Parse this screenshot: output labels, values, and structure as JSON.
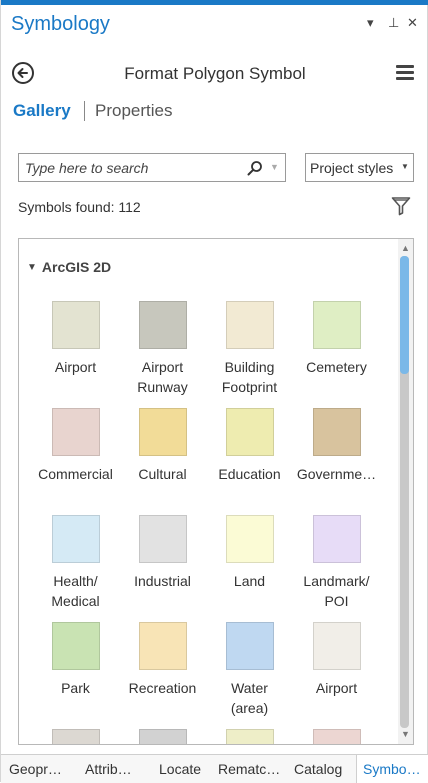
{
  "window": {
    "title": "Symbology",
    "controls": {
      "dropdown": "▾",
      "pin": "⊥",
      "close": "✕"
    }
  },
  "header": {
    "title": "Format Polygon Symbol"
  },
  "tabs": {
    "gallery": "Gallery",
    "properties": "Properties"
  },
  "search": {
    "placeholder": "Type here to search",
    "value": ""
  },
  "styles_dropdown": {
    "selected": "Project styles"
  },
  "results": {
    "found_text": "Symbols found: 112"
  },
  "group": {
    "name": "ArcGIS 2D"
  },
  "symbols": [
    {
      "name": "Airport",
      "color": "#e3e3d1"
    },
    {
      "name": "Airport\nRunway",
      "color": "#c7c7bd"
    },
    {
      "name": "Building\nFootprint",
      "color": "#f2ead3"
    },
    {
      "name": "Cemetery",
      "color": "#dfeec4"
    },
    {
      "name": "Commercial",
      "color": "#e8d4cf"
    },
    {
      "name": "Cultural",
      "color": "#f2dc98"
    },
    {
      "name": "Education",
      "color": "#eeecb0"
    },
    {
      "name": "Governme…",
      "color": "#d8c39e"
    },
    {
      "name": "Health/\nMedical",
      "color": "#d5eaf5"
    },
    {
      "name": "Industrial",
      "color": "#e2e2e2"
    },
    {
      "name": "Land",
      "color": "#fbfbd5"
    },
    {
      "name": "Landmark/\nPOI",
      "color": "#e7dcf7"
    },
    {
      "name": "Park",
      "color": "#c9e3b3"
    },
    {
      "name": "Recreation",
      "color": "#f8e4b6"
    },
    {
      "name": "Water\n(area)",
      "color": "#bfd8f1"
    },
    {
      "name": "Airport",
      "color": "#f1eee8"
    },
    {
      "name": "",
      "color": "#dcd8d2"
    },
    {
      "name": "",
      "color": "#d2d2d2"
    },
    {
      "name": "",
      "color": "#eeeec8"
    },
    {
      "name": "",
      "color": "#ecd6d2"
    }
  ],
  "bottom_tabs": [
    {
      "label": "Geopr…",
      "active": false
    },
    {
      "label": "Attrib…",
      "active": false
    },
    {
      "label": "Locate",
      "active": false
    },
    {
      "label": "Rematc…",
      "active": false
    },
    {
      "label": "Catalog",
      "active": false
    },
    {
      "label": "Symbo…",
      "active": true
    }
  ],
  "colors": {
    "accent": "#1a79c6",
    "scroll_thumb": "#7ab8e8"
  }
}
